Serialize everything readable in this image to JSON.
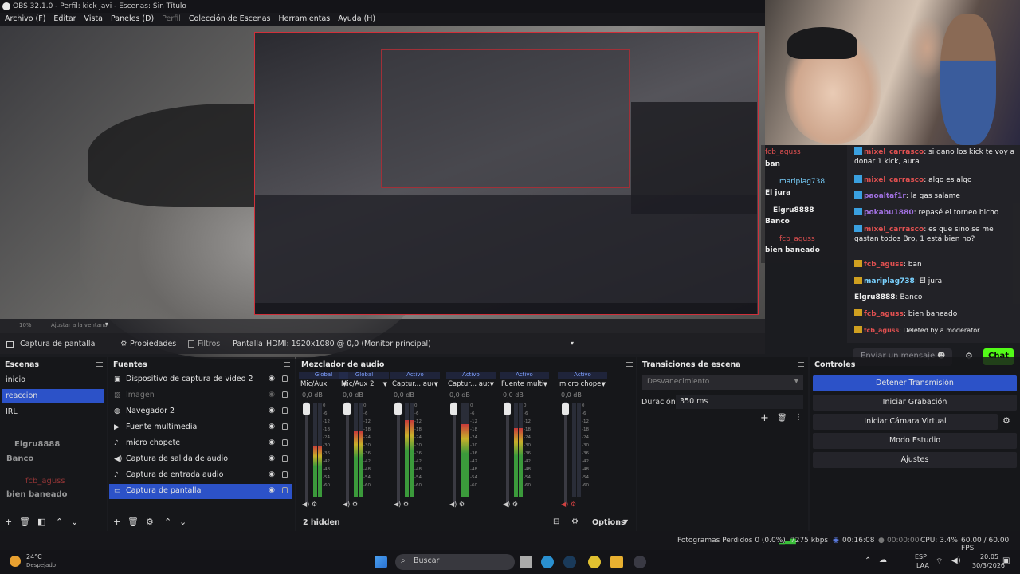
{
  "window": {
    "title": "OBS 32.1.0 - Perfil: kick javi - Escenas: Sin Título"
  },
  "menu": {
    "items": [
      "Archivo (F)",
      "Editar",
      "Vista",
      "Paneles (D)",
      "Perfil",
      "Colección de Escenas",
      "Herramientas",
      "Ayuda (H)"
    ]
  },
  "preview": {
    "zoom_text": "10%",
    "fit_text": "Ajustar a la ventana"
  },
  "source_toolbar": {
    "source_name": "Captura de pantalla",
    "properties": "Propiedades",
    "filters": "Filtros",
    "display_label": "Pantalla",
    "display_value": "HDMI: 1920x1080 @ 0,0 (Monitor principal)"
  },
  "chat_overlay": {
    "left_messages": [
      {
        "user": "fcb_aguss",
        "text": "ban"
      },
      {
        "user": "mariplag738",
        "text": "El jura"
      },
      {
        "user": "Elgru8888",
        "text": "Banco"
      },
      {
        "user": "fcb_aguss",
        "text": "bien baneado"
      }
    ],
    "lines": [
      {
        "user": "mixel_carrasco",
        "text": ": si gano los kick te voy a donar 1 kick, aura"
      },
      {
        "user": "mixel_carrasco",
        "text": ": algo es algo"
      },
      {
        "user": "paoaltaf1r",
        "text": ": la gas salame"
      },
      {
        "user": "pokabu1880",
        "text": ": repasé el torneo bicho"
      },
      {
        "user": "mixel_carrasco",
        "text": ": es que sino se me gastan todos Bro, 1 está bien no?"
      },
      {
        "user": "fcb_aguss",
        "text": ": ban"
      },
      {
        "user": "mariplag738",
        "text": ": El jura"
      },
      {
        "user": "Elgru8888",
        "text": ": Banco"
      },
      {
        "user": "fcb_aguss",
        "text": ": bien baneado"
      },
      {
        "user": "fcb_aguss",
        "text": ": Deleted by a moderator"
      }
    ],
    "input_placeholder": "Enviar un mensaje",
    "send_button": "Chat"
  },
  "scenes": {
    "title": "Escenas",
    "items": [
      "inicio",
      "reaccion",
      "IRL"
    ],
    "selected_index": 1,
    "overlay_user1": "Elgru8888",
    "overlay_text1": "Banco",
    "overlay_user2": "fcb_aguss",
    "overlay_text2": "bien baneado"
  },
  "sources": {
    "title": "Fuentes",
    "items": [
      {
        "label": "Dispositivo de captura de video 2",
        "icon": "camera-icon"
      },
      {
        "label": "Imagen",
        "icon": "image-icon"
      },
      {
        "label": "Navegador 2",
        "icon": "globe-icon"
      },
      {
        "label": "Fuente multimedia",
        "icon": "play-icon"
      },
      {
        "label": "micro chopete",
        "icon": "mic-icon"
      },
      {
        "label": "Captura de salida de audio",
        "icon": "speaker-icon"
      },
      {
        "label": "Captura de entrada audio",
        "icon": "mic-icon"
      },
      {
        "label": "Captura de pantalla",
        "icon": "monitor-icon"
      }
    ],
    "selected_index": 7
  },
  "mixer": {
    "title": "Mezclador de audio",
    "channels": [
      {
        "tag": "Global",
        "name": "Mic/Aux",
        "db": "0,0 dB",
        "level": 0.55
      },
      {
        "tag": "Global",
        "name": "Mic/Aux 2",
        "db": "0,0 dB",
        "level": 0.7
      },
      {
        "tag": "Activo",
        "name": "Captur... audio",
        "db": "0,0 dB",
        "level": 0.82
      },
      {
        "tag": "Activo",
        "name": "Captur... audio",
        "db": "0,0 dB",
        "level": 0.78
      },
      {
        "tag": "Activo",
        "name": "Fuente multimec",
        "db": "0,0 dB",
        "level": 0.74
      },
      {
        "tag": "Activo",
        "name": "micro chopete",
        "db": "0,0 dB",
        "level": 0.0
      }
    ],
    "ticks": [
      "0",
      "-6",
      "-12",
      "-18",
      "-24",
      "-30",
      "-36",
      "-42",
      "-48",
      "-54",
      "-60"
    ],
    "hidden": "2 hidden",
    "options": "Options"
  },
  "transitions": {
    "title": "Transiciones de escena",
    "selected": "Desvanecimiento",
    "duration_label": "Duración",
    "duration_value": "350 ms"
  },
  "controls": {
    "title": "Controles",
    "stop_stream": "Detener Transmisión",
    "start_recording": "Iniciar Grabación",
    "virtual_cam": "Iniciar Cámara Virtual",
    "studio_mode": "Modo Estudio",
    "settings": "Ajustes"
  },
  "status": {
    "dropped": "Fotogramas Perdidos 0 (0.0%)",
    "bitrate": "7275 kbps",
    "stream_time": "00:16:08",
    "rec_time": "00:00:00",
    "cpu": "CPU: 3.4%",
    "fps": "60.00 / 60.00 FPS"
  },
  "taskbar": {
    "weather_temp": "24°C",
    "weather_desc": "Despejado",
    "search": "Buscar",
    "lang1": "ESP",
    "lang2": "LAA",
    "time": "20:05",
    "date": "30/3/2026"
  },
  "colors": {
    "accent": "#2c52c8",
    "kick_green": "#53fc18",
    "preview_border": "#d0303a"
  }
}
